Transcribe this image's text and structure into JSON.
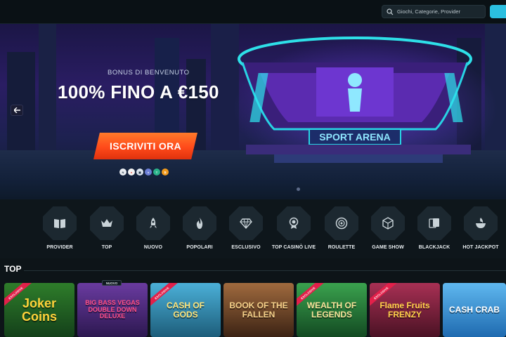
{
  "topbar": {
    "search_placeholder": "Giochi, Categorie, Provider",
    "icons": {
      "search": "search-icon"
    },
    "accent_color": "#2bbfe0"
  },
  "hero": {
    "welcome_label": "BONUS DI BENVENUTO",
    "headline": "100% FINO A €150",
    "cta_label": "ISCRIVITI ORA",
    "arena_sign": "SPORT ARENA",
    "payment_icons": [
      "nexi-icon",
      "mastercard-icon",
      "bank-icon",
      "ethereum-icon",
      "tether-icon",
      "bitcoin-icon"
    ],
    "cta_color": "#ff5a1e"
  },
  "categories": [
    {
      "label": "PROVIDER",
      "icon": "book-icon"
    },
    {
      "label": "TOP",
      "icon": "crown-icon"
    },
    {
      "label": "NUOVO",
      "icon": "rocket-icon"
    },
    {
      "label": "POPOLARI",
      "icon": "flame-icon"
    },
    {
      "label": "ESCLUSIVO",
      "icon": "diamond-icon"
    },
    {
      "label": "TOP CASINÒ LIVE",
      "icon": "medal-icon"
    },
    {
      "label": "ROULETTE",
      "icon": "roulette-icon"
    },
    {
      "label": "GAME SHOW",
      "icon": "dice-icon"
    },
    {
      "label": "BLACKJACK",
      "icon": "cards-icon"
    },
    {
      "label": "HOT JACKPOT",
      "icon": "fire-pot-icon"
    }
  ],
  "top_section": {
    "title": "TOP",
    "new_badge": "NUOVO",
    "exclusive_badge": "EXCLUSIVE",
    "games": [
      {
        "title": "Joker Coins",
        "bg": "#1f5a26"
      },
      {
        "title": "BIG BASS VEGAS DOUBLE DOWN DELUXE",
        "bg": "#4a2a6e"
      },
      {
        "title": "CASH OF GODS",
        "bg": "#2f7c9a"
      },
      {
        "title": "BOOK OF THE FALLEN",
        "bg": "#7a4b32"
      },
      {
        "title": "WEALTH OF LEGENDS",
        "bg": "#2c7e3e"
      },
      {
        "title": "Flame Fruits FRENZY",
        "bg": "#7a2438"
      },
      {
        "title": "CASH CRAB",
        "bg": "#2d8bd4"
      }
    ]
  }
}
